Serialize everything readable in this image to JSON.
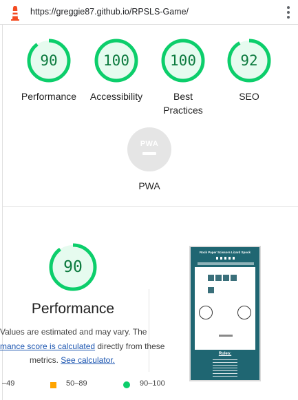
{
  "header": {
    "url": "https://greggie87.github.io/RPSLS-Game/"
  },
  "colors": {
    "pass": "#0cce6b",
    "pass_text": "#0c7a3e",
    "pass_fill": "#e6fbef",
    "average": "#ffa400",
    "pwa_gray": "#e5e5e5"
  },
  "categories": [
    {
      "label": "Performance",
      "score": "90",
      "fraction": 0.9
    },
    {
      "label": "Accessibility",
      "score": "100",
      "fraction": 1.0
    },
    {
      "label_line1": "Best",
      "label_line2": "Practices",
      "score": "100",
      "fraction": 1.0
    },
    {
      "label": "SEO",
      "score": "92",
      "fraction": 0.92
    }
  ],
  "pwa": {
    "badge_text": "PWA",
    "label": "PWA"
  },
  "performance": {
    "score": "90",
    "fraction": 0.9,
    "title": "Performance",
    "desc_line1": "Values are estimated and may vary. The",
    "desc_link1": "mance score is calculated",
    "desc_line2_rest": " directly from these",
    "desc_line3": "metrics.",
    "desc_link2": "See calculator."
  },
  "legend": [
    {
      "range": "–49",
      "icon": "fail-triangle-icon"
    },
    {
      "range": "50–89",
      "icon": "average-square-icon"
    },
    {
      "range": "90–100",
      "icon": "pass-circle-icon"
    }
  ],
  "thumbnail": {
    "title": "Rock Paper Scissors Lizard Spock",
    "rules_heading": "Rules:"
  }
}
